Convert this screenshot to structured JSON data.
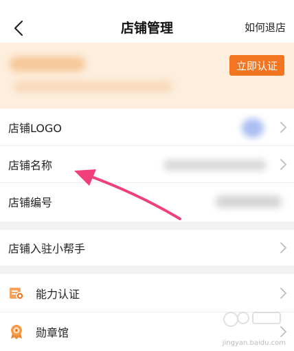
{
  "navbar": {
    "title": "店铺管理",
    "help_link": "如何退店",
    "back_icon": "chevron-left-icon"
  },
  "banner": {
    "certify_button": "立即认证",
    "colors": {
      "background": "#fdeedd",
      "button": "#f47521"
    }
  },
  "store_section": {
    "items": [
      {
        "label": "店铺LOGO",
        "icon": "chevron-right-icon"
      },
      {
        "label": "店铺名称",
        "icon": "chevron-right-icon"
      },
      {
        "label": "店铺编号"
      }
    ]
  },
  "helper_section": {
    "items": [
      {
        "label": "店铺入驻小帮手",
        "icon": "chevron-right-icon"
      }
    ]
  },
  "feature_section": {
    "items": [
      {
        "label": "能力认证",
        "leading_icon": "certificate-icon",
        "icon": "chevron-right-icon"
      },
      {
        "label": "勋章馆",
        "leading_icon": "medal-icon",
        "icon": "chevron-right-icon"
      }
    ]
  },
  "annotation": {
    "color": "#f0407a",
    "icon": "arrow-annotation-icon"
  },
  "watermark": {
    "text": "jingyan.baidu.com"
  }
}
